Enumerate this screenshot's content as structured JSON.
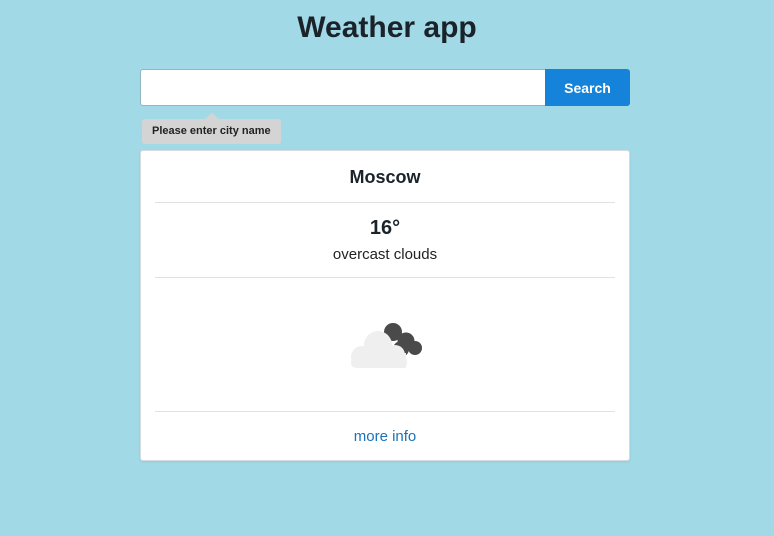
{
  "app": {
    "title": "Weather app"
  },
  "search": {
    "value": "",
    "placeholder": "",
    "button_label": "Search",
    "validation_message": "Please enter city name"
  },
  "weather_card": {
    "city": "Moscow",
    "temperature": "16°",
    "description": "overcast clouds",
    "icon": "overcast-clouds-icon",
    "more_info_label": "more info"
  },
  "colors": {
    "background": "#a2d9e6",
    "accent": "#1583d9",
    "link": "#1a73b8"
  }
}
